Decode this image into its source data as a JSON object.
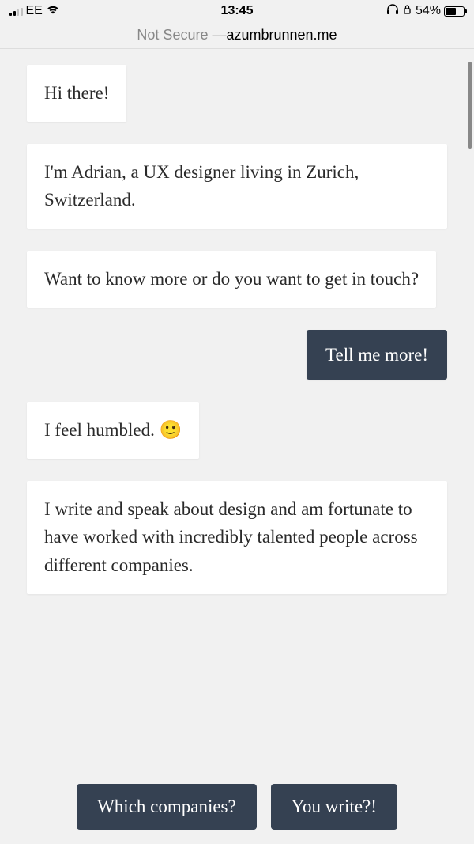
{
  "statusBar": {
    "carrier": "EE",
    "time": "13:45",
    "batteryPercent": "54%"
  },
  "browserBar": {
    "security": "Not Secure — ",
    "domain": "azumbrunnen.me"
  },
  "messages": {
    "m1": "Hi there!",
    "m2": "I'm Adrian, a UX designer living in Zurich, Switzerland.",
    "m3": "Want to know more or do you want to get in touch?",
    "m4": "Tell me more!",
    "m5": "I feel humbled. 🙂",
    "m6": "I write and speak about design and am fortunate to have worked with incredibly talented people across different companies."
  },
  "actions": {
    "left": "Which companies?",
    "right": "You write?!"
  }
}
